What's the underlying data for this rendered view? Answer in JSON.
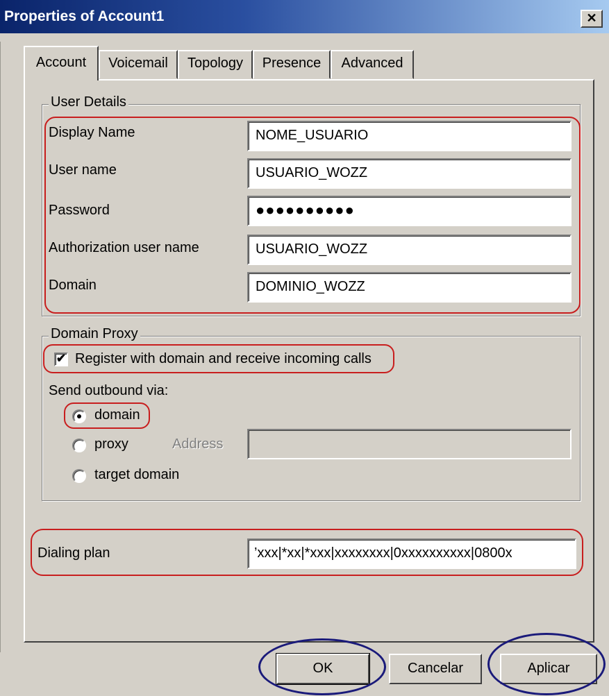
{
  "window": {
    "title": "Properties of Account1",
    "close_glyph": "✕"
  },
  "tabs": [
    {
      "label": "Account",
      "active": true
    },
    {
      "label": "Voicemail",
      "active": false
    },
    {
      "label": "Topology",
      "active": false
    },
    {
      "label": "Presence",
      "active": false
    },
    {
      "label": "Advanced",
      "active": false
    }
  ],
  "user_details": {
    "group_label": "User Details",
    "display_name": {
      "label": "Display Name",
      "value": "NOME_USUARIO"
    },
    "user_name": {
      "label": "User name",
      "value": "USUARIO_WOZZ"
    },
    "password": {
      "label": "Password",
      "value": "●●●●●●●●●●"
    },
    "auth_user_name": {
      "label": "Authorization user name",
      "value": "USUARIO_WOZZ"
    },
    "domain": {
      "label": "Domain",
      "value": "DOMINIO_WOZZ"
    }
  },
  "domain_proxy": {
    "group_label": "Domain Proxy",
    "register": {
      "label": "Register with domain and receive incoming calls",
      "checked": true,
      "glyph": "✔"
    },
    "send_outbound_label": "Send outbound via:",
    "options": [
      {
        "label": "domain",
        "selected": true
      },
      {
        "label": "proxy",
        "selected": false
      },
      {
        "label": "target domain",
        "selected": false
      }
    ],
    "address_label": "Address",
    "address_value": ""
  },
  "dialing_plan": {
    "label": "Dialing plan",
    "value": "’xxx|*xx|*xxx|xxxxxxxx|0xxxxxxxxxx|0800x"
  },
  "buttons": {
    "ok": "OK",
    "cancel": "Cancelar",
    "apply": "Aplicar"
  },
  "colors": {
    "annotation_red": "#c81e1e",
    "annotation_blue": "#1a1a7a",
    "dialog_bg": "#d4d0c8",
    "titlebar_start": "#0a246a"
  }
}
